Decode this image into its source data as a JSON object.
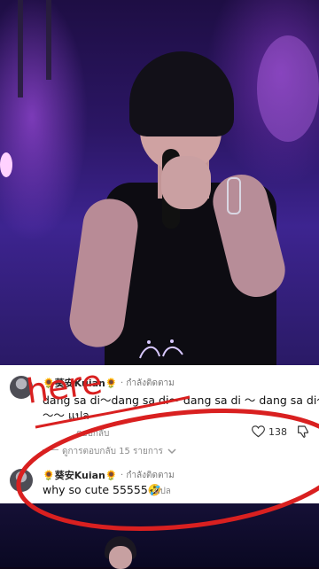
{
  "comment_1": {
    "username": "🌻葵安Kuian🌻",
    "follow_status": "· กำลังติดตาม",
    "text_line1": "dang sa di～dang sa di～ dang sa di ～ dang sa di～",
    "text_line2": "～～ แปล",
    "reply_label": "ตอบกลับ",
    "likes": "138",
    "view_replies": "ดูการตอบกลับ 15 รายการ"
  },
  "comment_2": {
    "username": "🌻葵安Kuian🌻",
    "follow_status": "· กำลังติดตาม",
    "text": "why so cute 55555🤣",
    "translate_label": "แปล"
  },
  "annotation": {
    "text": "here",
    "color": "#d92020"
  },
  "icons": {
    "like": "heart-icon",
    "dislike": "thumbs-down-icon",
    "expand": "chevron-down-icon"
  },
  "colors": {
    "stage_purple": "#3d2490",
    "card_bg": "#ffffff",
    "annotation_red": "#d92020"
  }
}
